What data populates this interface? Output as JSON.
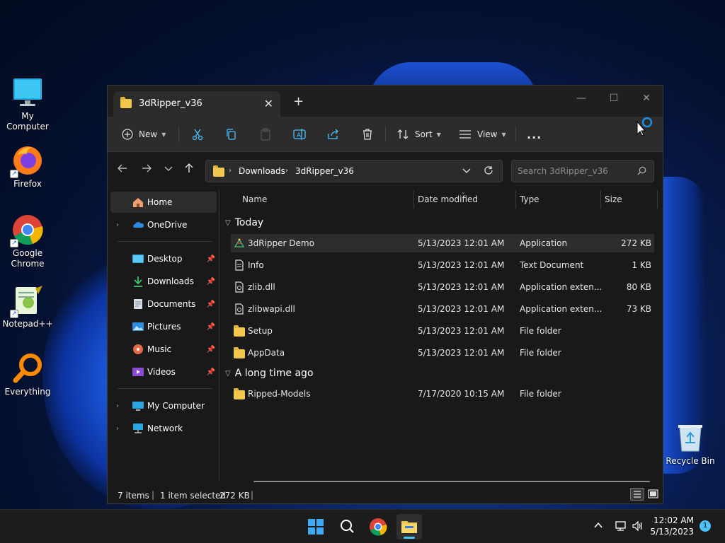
{
  "desktop": {
    "icons": [
      {
        "label": "My Computer",
        "icon": "monitor-icon"
      },
      {
        "label": "Firefox",
        "icon": "firefox-icon"
      },
      {
        "label": "Google Chrome",
        "icon": "chrome-icon"
      },
      {
        "label": "Notepad++",
        "icon": "notepadpp-icon"
      },
      {
        "label": "Everything",
        "icon": "everything-icon"
      },
      {
        "label": "Recycle Bin",
        "icon": "recycle-bin-icon"
      }
    ]
  },
  "window": {
    "tab_title": "3dRipper_v36",
    "new_tab": "+",
    "controls": {
      "minimize": "—",
      "maximize": "☐",
      "close": "✕"
    },
    "toolbar": {
      "new_label": "New",
      "sort_label": "Sort",
      "view_label": "View",
      "more_label": "..."
    },
    "address": {
      "crumbs": [
        "Downloads",
        "3dRipper_v36"
      ],
      "search_placeholder": "Search 3dRipper_v36"
    },
    "sidebar": {
      "items": [
        {
          "label": "Home",
          "icon": "home-icon",
          "selected": true
        },
        {
          "label": "OneDrive",
          "icon": "onedrive-icon"
        },
        {
          "label": "Desktop",
          "icon": "desktop-icon",
          "pinned": true
        },
        {
          "label": "Downloads",
          "icon": "download-icon",
          "pinned": true
        },
        {
          "label": "Documents",
          "icon": "documents-icon",
          "pinned": true
        },
        {
          "label": "Pictures",
          "icon": "pictures-icon",
          "pinned": true
        },
        {
          "label": "Music",
          "icon": "music-icon",
          "pinned": true
        },
        {
          "label": "Videos",
          "icon": "videos-icon",
          "pinned": true
        },
        {
          "label": "My Computer",
          "icon": "computer-icon"
        },
        {
          "label": "Network",
          "icon": "network-icon"
        }
      ]
    },
    "columns": {
      "name": "Name",
      "date": "Date modified",
      "type": "Type",
      "size": "Size"
    },
    "groups": [
      {
        "label": "Today",
        "rows": [
          {
            "name": "3dRipper Demo",
            "date": "5/13/2023 12:01 AM",
            "type": "Application",
            "size": "272 KB",
            "icon": "application-icon",
            "selected": true
          },
          {
            "name": "Info",
            "date": "5/13/2023 12:01 AM",
            "type": "Text Document",
            "size": "1 KB",
            "icon": "text-file-icon"
          },
          {
            "name": "zlib.dll",
            "date": "5/13/2023 12:01 AM",
            "type": "Application exten...",
            "size": "80 KB",
            "icon": "dll-file-icon"
          },
          {
            "name": "zlibwapi.dll",
            "date": "5/13/2023 12:01 AM",
            "type": "Application exten...",
            "size": "73 KB",
            "icon": "dll-file-icon"
          },
          {
            "name": "Setup",
            "date": "5/13/2023 12:01 AM",
            "type": "File folder",
            "size": "",
            "icon": "folder-icon"
          },
          {
            "name": "AppData",
            "date": "5/13/2023 12:01 AM",
            "type": "File folder",
            "size": "",
            "icon": "folder-icon"
          }
        ]
      },
      {
        "label": "A long time ago",
        "rows": [
          {
            "name": "Ripped-Models",
            "date": "7/17/2020 10:15 AM",
            "type": "File folder",
            "size": "",
            "icon": "folder-icon"
          }
        ]
      }
    ],
    "status": {
      "items": "7 items",
      "selection": "1 item selected",
      "selection_size": "272 KB"
    }
  },
  "taskbar": {
    "clock_time": "12:02 AM",
    "clock_date": "5/13/2023",
    "notification_count": "1"
  },
  "colors": {
    "accent": "#4cc2ff",
    "folder": "#f2c94c",
    "window_bg": "#191919",
    "toolbar_bg": "#2c2c2c"
  }
}
